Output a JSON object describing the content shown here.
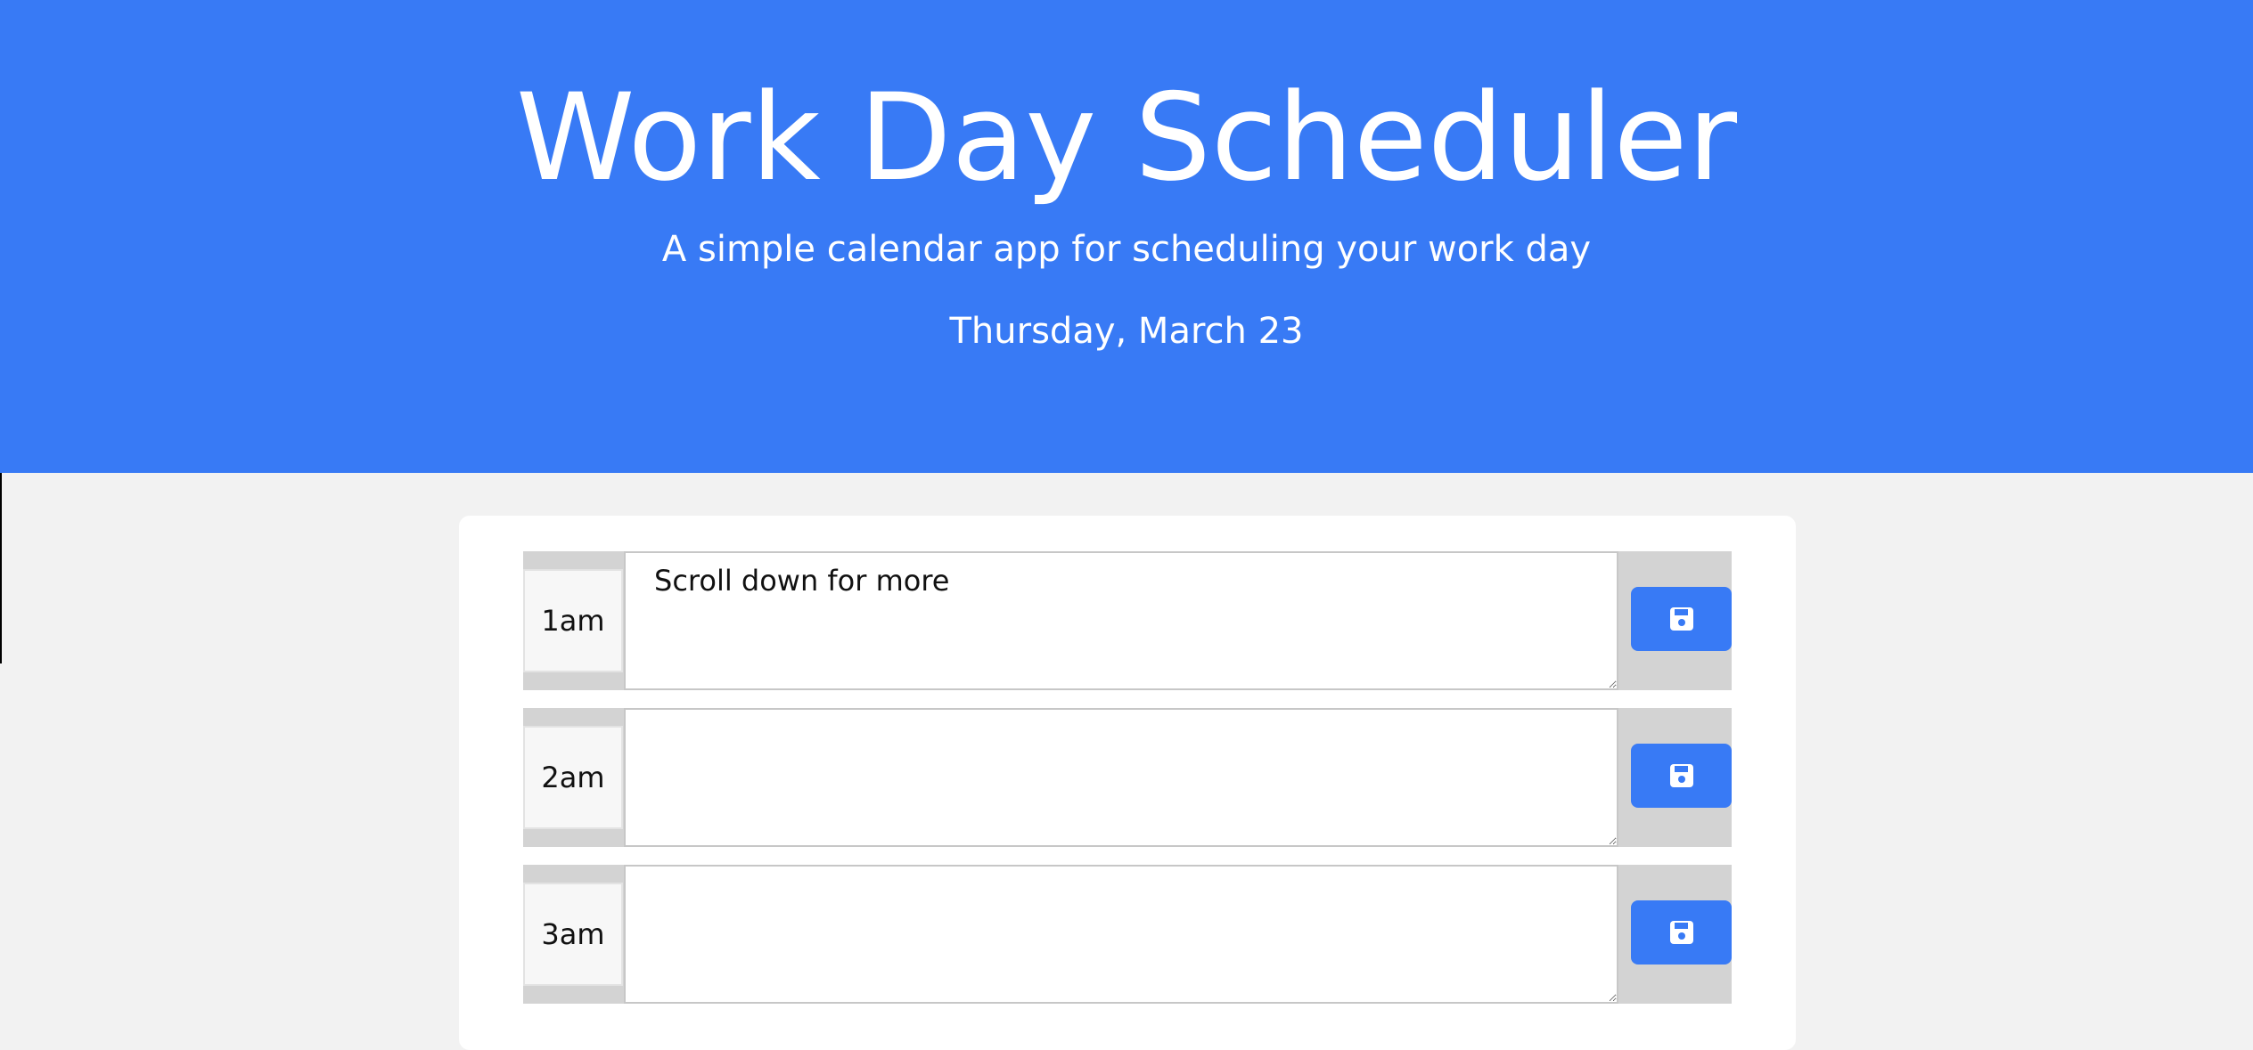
{
  "header": {
    "title": "Work Day Scheduler",
    "subtitle": "A simple calendar app for scheduling your work day",
    "current_date": "Thursday, March 23"
  },
  "colors": {
    "header_bg": "#387af5",
    "page_bg": "#f2f2f2",
    "row_bg": "#d3d3d3",
    "save_button": "#387af5"
  },
  "time_blocks": [
    {
      "hour": "1am",
      "task": "Scroll down for more",
      "save_icon": "floppy-disk-icon"
    },
    {
      "hour": "2am",
      "task": "",
      "save_icon": "floppy-disk-icon"
    },
    {
      "hour": "3am",
      "task": "",
      "save_icon": "floppy-disk-icon"
    }
  ]
}
